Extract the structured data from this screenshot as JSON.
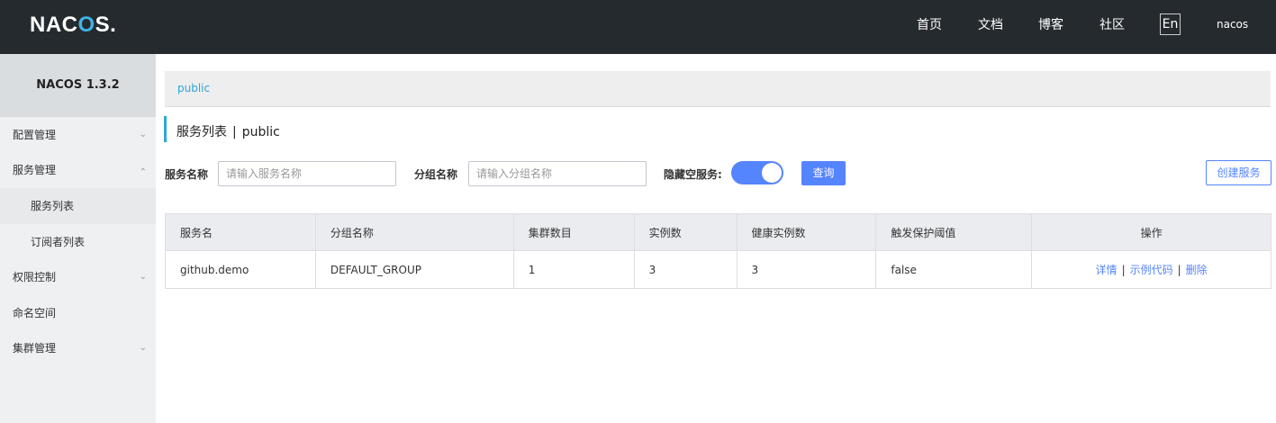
{
  "header": {
    "logo_text_pre": "NAC",
    "logo_text_o": "O",
    "logo_text_post": "S.",
    "nav": [
      "首页",
      "文档",
      "博客",
      "社区"
    ],
    "lang_button": "En",
    "user": "nacos"
  },
  "sidebar": {
    "version": "NACOS 1.3.2",
    "items": [
      {
        "label": "配置管理",
        "chevron": "chevron-down-icon"
      },
      {
        "label": "服务管理",
        "chevron": "chevron-up-icon"
      },
      {
        "label": "服务列表"
      },
      {
        "label": "订阅者列表"
      },
      {
        "label": "权限控制",
        "chevron": "chevron-down-icon"
      },
      {
        "label": "命名空间"
      },
      {
        "label": "集群管理",
        "chevron": "chevron-down-icon"
      }
    ]
  },
  "breadcrumb": {
    "namespace": "public"
  },
  "page_title": {
    "title": "服务列表",
    "separator": "|",
    "namespace": "public"
  },
  "filters": {
    "service_name_label": "服务名称",
    "service_name_placeholder": "请输入服务名称",
    "group_name_label": "分组名称",
    "group_name_placeholder": "请输入分组名称",
    "hide_empty_label": "隐藏空服务:",
    "hide_empty_on": true,
    "query_button": "查询",
    "create_button": "创建服务"
  },
  "table": {
    "headers": [
      "服务名",
      "分组名称",
      "集群数目",
      "实例数",
      "健康实例数",
      "触发保护阈值",
      "操作"
    ],
    "rows": [
      {
        "service": "github.demo",
        "group": "DEFAULT_GROUP",
        "clusters": "1",
        "instances": "3",
        "healthy": "3",
        "protect": "false"
      }
    ],
    "actions": [
      "详情",
      "示例代码",
      "删除"
    ],
    "action_separator": "|"
  },
  "colors": {
    "accent": "#5584ff",
    "link": "#2ca6d9",
    "topbar": "#252a2f"
  }
}
